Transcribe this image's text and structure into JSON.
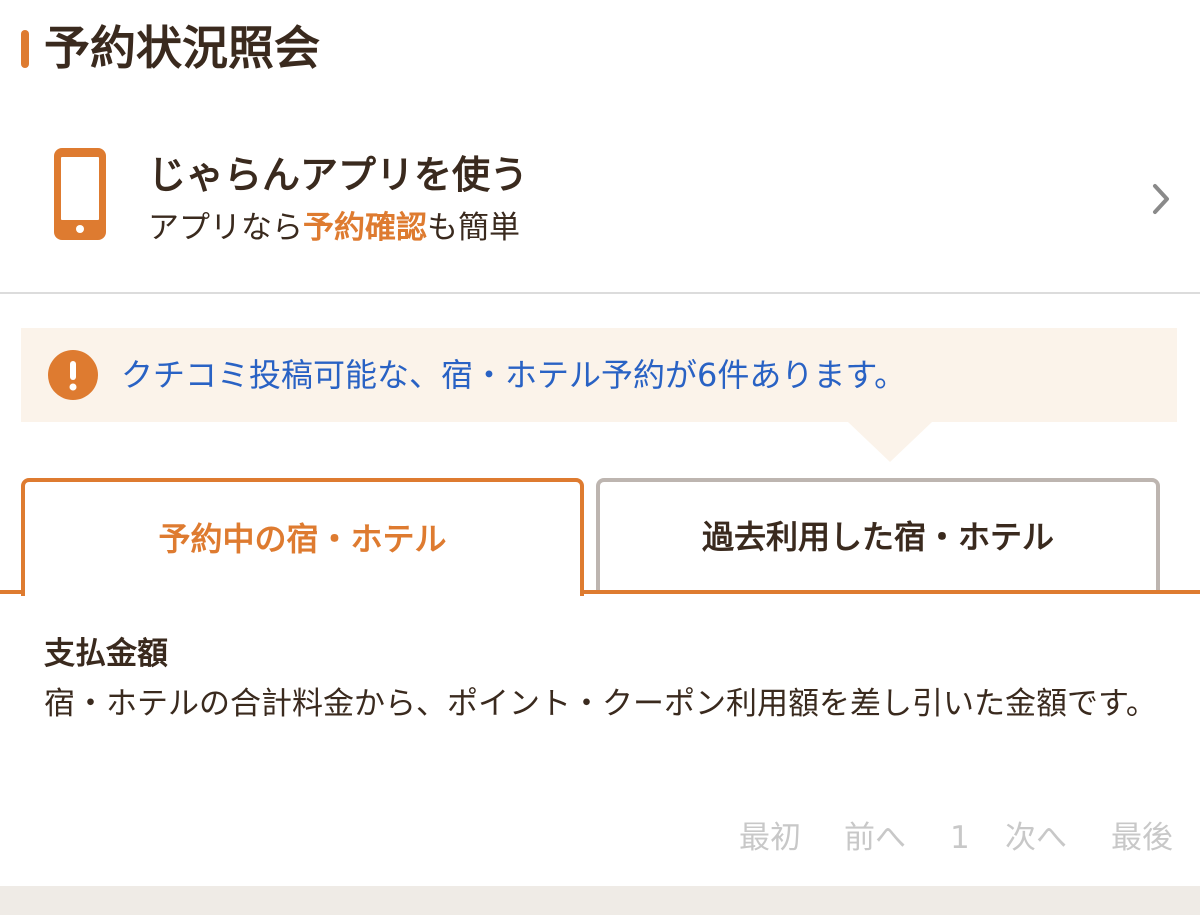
{
  "header": {
    "title": "予約状況照会"
  },
  "app_promo": {
    "icon": "smartphone-icon",
    "title": "じゃらんアプリを使う",
    "subtitle_before": "アプリなら",
    "subtitle_highlight": "予約確認",
    "subtitle_after": "も簡単",
    "chevron": "chevron-right-icon"
  },
  "notice": {
    "icon": "exclamation-icon",
    "text": "クチコミ投稿可能な、宿・ホテル予約が6件あります。"
  },
  "tabs": [
    {
      "label": "予約中の宿・ホテル",
      "active": true
    },
    {
      "label": "過去利用した宿・ホテル",
      "active": false
    }
  ],
  "payment": {
    "label": "支払金額",
    "description": "宿・ホテルの合計料金から、ポイント・クーポン利用額を差し引いた金額です。"
  },
  "pagination": {
    "first": "最初",
    "prev": "前へ",
    "current": "1",
    "next": "次へ",
    "last": "最後"
  },
  "colors": {
    "accent": "#de7b30",
    "link": "#2962c4",
    "notice_bg": "#fbf3ea",
    "text": "#3a2a1e",
    "disabled": "#c8c8c8"
  }
}
